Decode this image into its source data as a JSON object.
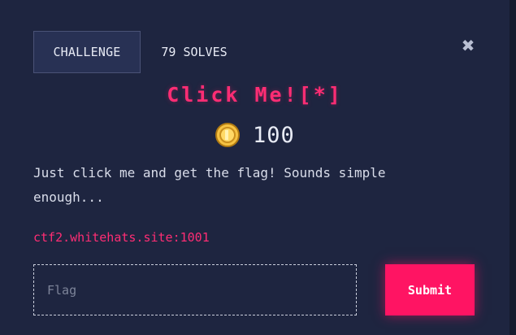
{
  "tabs": {
    "challenge_label": "CHALLENGE",
    "solves_label": "79 SOLVES"
  },
  "close": {
    "glyph": "✖"
  },
  "challenge": {
    "name": "Click Me![*]",
    "points": "100",
    "description": "Just click me and get the flag! Sounds simple enough...",
    "link": "ctf2.whitehats.site:1001"
  },
  "form": {
    "flag_placeholder": "Flag",
    "flag_value": "",
    "submit_label": "Submit"
  },
  "icons": {
    "coin": "coin-icon",
    "close": "close-icon"
  },
  "colors": {
    "accent": "#ff2d74",
    "button": "#ff1463",
    "background": "#1e2540",
    "coin": "#f5c242"
  }
}
